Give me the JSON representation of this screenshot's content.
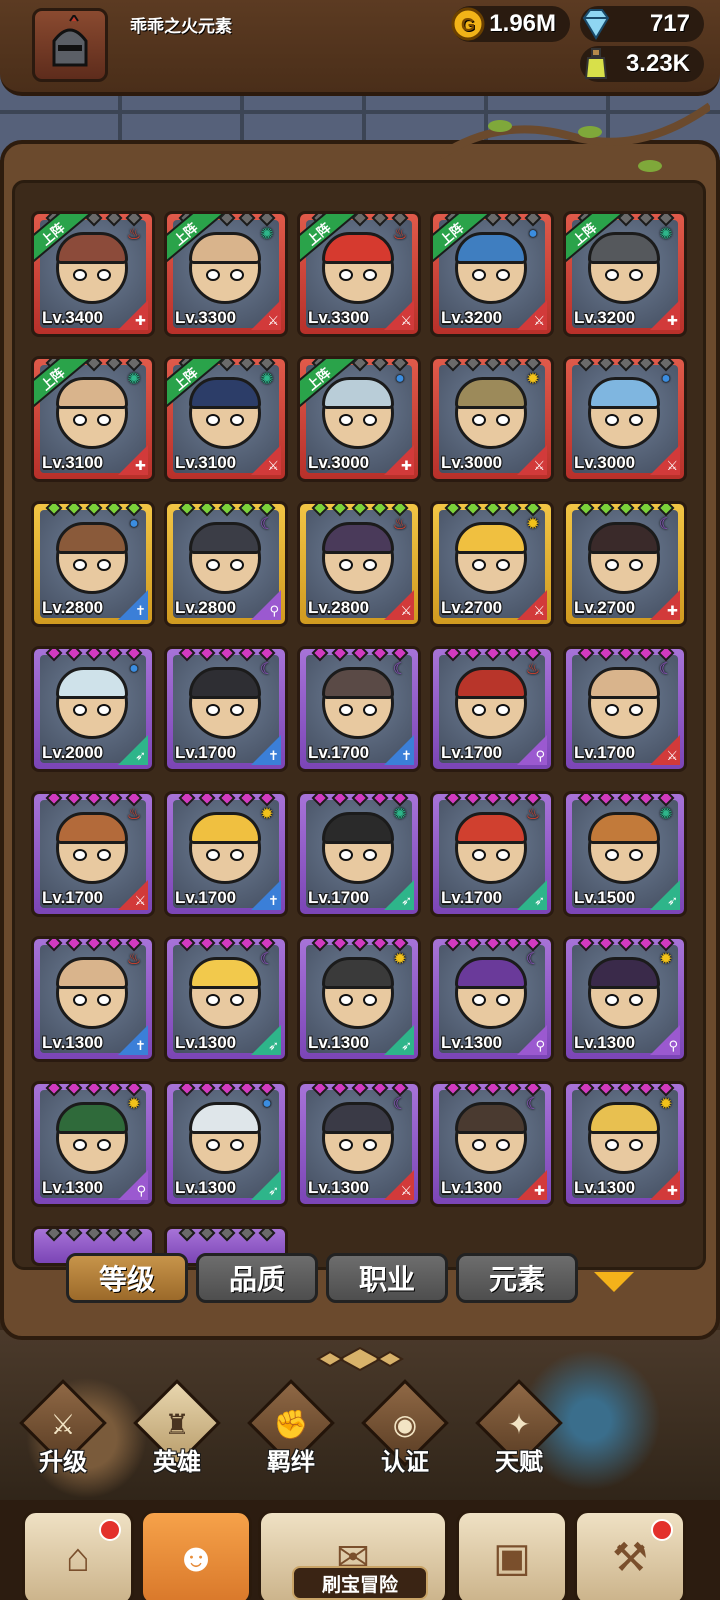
{
  "player": {
    "name": "乖乖之火元素"
  },
  "resources": {
    "gold": "1.96M",
    "gems": "717",
    "potions": "3.23K"
  },
  "deploy_tag": "上阵",
  "heroes": [
    {
      "level": "Lv.3400",
      "rarity": "red",
      "deployed": true,
      "element": "fire",
      "class": "guardian",
      "color": "#8c4b3a"
    },
    {
      "level": "Lv.3300",
      "rarity": "red",
      "deployed": true,
      "element": "wind",
      "class": "warrior",
      "color": "#d9b48c"
    },
    {
      "level": "Lv.3300",
      "rarity": "red",
      "deployed": true,
      "element": "fire",
      "class": "warrior",
      "color": "#d63a2f"
    },
    {
      "level": "Lv.3200",
      "rarity": "red",
      "deployed": true,
      "element": "water",
      "class": "warrior",
      "color": "#3f7ec0"
    },
    {
      "level": "Lv.3200",
      "rarity": "red",
      "deployed": true,
      "element": "wind",
      "class": "guardian",
      "color": "#55585c"
    },
    {
      "level": "Lv.3100",
      "rarity": "red",
      "deployed": true,
      "element": "wind",
      "class": "guardian",
      "color": "#d9b48c"
    },
    {
      "level": "Lv.3100",
      "rarity": "red",
      "deployed": true,
      "element": "wind",
      "class": "warrior",
      "color": "#2c3d68"
    },
    {
      "level": "Lv.3000",
      "rarity": "red",
      "deployed": true,
      "element": "water",
      "class": "guardian",
      "color": "#b9cdd8"
    },
    {
      "level": "Lv.3000",
      "rarity": "red",
      "deployed": false,
      "element": "light",
      "class": "warrior",
      "color": "#9c8a5a"
    },
    {
      "level": "Lv.3000",
      "rarity": "red",
      "deployed": false,
      "element": "water",
      "class": "warrior",
      "color": "#7fb6e0"
    },
    {
      "level": "Lv.2800",
      "rarity": "gold",
      "deployed": false,
      "element": "water",
      "class": "priest",
      "color": "#8a5a3a"
    },
    {
      "level": "Lv.2800",
      "rarity": "gold",
      "deployed": false,
      "element": "dark",
      "class": "mage",
      "color": "#3b3d46"
    },
    {
      "level": "Lv.2800",
      "rarity": "gold",
      "deployed": false,
      "element": "fire",
      "class": "warrior",
      "color": "#4a3a5a"
    },
    {
      "level": "Lv.2700",
      "rarity": "gold",
      "deployed": false,
      "element": "light",
      "class": "warrior",
      "color": "#f0c040"
    },
    {
      "level": "Lv.2700",
      "rarity": "gold",
      "deployed": false,
      "element": "dark",
      "class": "guardian",
      "color": "#3a2a2a"
    },
    {
      "level": "Lv.2000",
      "rarity": "purple",
      "deployed": false,
      "element": "water",
      "class": "ranger",
      "color": "#cfe2ea"
    },
    {
      "level": "Lv.1700",
      "rarity": "purple",
      "deployed": false,
      "element": "dark",
      "class": "priest",
      "color": "#2e2e33"
    },
    {
      "level": "Lv.1700",
      "rarity": "purple",
      "deployed": false,
      "element": "dark",
      "class": "priest",
      "color": "#5a4a46"
    },
    {
      "level": "Lv.1700",
      "rarity": "purple",
      "deployed": false,
      "element": "fire",
      "class": "mage",
      "color": "#b8352a"
    },
    {
      "level": "Lv.1700",
      "rarity": "purple",
      "deployed": false,
      "element": "dark",
      "class": "warrior",
      "color": "#d9b48c"
    },
    {
      "level": "Lv.1700",
      "rarity": "purple",
      "deployed": false,
      "element": "fire",
      "class": "warrior",
      "color": "#b36a3a"
    },
    {
      "level": "Lv.1700",
      "rarity": "purple",
      "deployed": false,
      "element": "light",
      "class": "priest",
      "color": "#f0c040"
    },
    {
      "level": "Lv.1700",
      "rarity": "purple",
      "deployed": false,
      "element": "wind",
      "class": "ranger",
      "color": "#2a2a2a"
    },
    {
      "level": "Lv.1700",
      "rarity": "purple",
      "deployed": false,
      "element": "fire",
      "class": "ranger",
      "color": "#d0402f"
    },
    {
      "level": "Lv.1500",
      "rarity": "purple",
      "deployed": false,
      "element": "wind",
      "class": "ranger",
      "color": "#c27a3a"
    },
    {
      "level": "Lv.1300",
      "rarity": "purple",
      "deployed": false,
      "element": "fire",
      "class": "priest",
      "color": "#d9b48c"
    },
    {
      "level": "Lv.1300",
      "rarity": "purple",
      "deployed": false,
      "element": "dark",
      "class": "ranger",
      "color": "#f2c94c"
    },
    {
      "level": "Lv.1300",
      "rarity": "purple",
      "deployed": false,
      "element": "light",
      "class": "ranger",
      "color": "#3a3a3a"
    },
    {
      "level": "Lv.1300",
      "rarity": "purple",
      "deployed": false,
      "element": "dark",
      "class": "mage",
      "color": "#6a3a9a"
    },
    {
      "level": "Lv.1300",
      "rarity": "purple",
      "deployed": false,
      "element": "light",
      "class": "mage",
      "color": "#3a2a4a"
    },
    {
      "level": "Lv.1300",
      "rarity": "purple",
      "deployed": false,
      "element": "light",
      "class": "mage",
      "color": "#2f6a3a"
    },
    {
      "level": "Lv.1300",
      "rarity": "purple",
      "deployed": false,
      "element": "water",
      "class": "ranger",
      "color": "#dfe6ea"
    },
    {
      "level": "Lv.1300",
      "rarity": "purple",
      "deployed": false,
      "element": "dark",
      "class": "warrior",
      "color": "#3a3a46"
    },
    {
      "level": "Lv.1300",
      "rarity": "purple",
      "deployed": false,
      "element": "dark",
      "class": "guardian",
      "color": "#4a3a30"
    },
    {
      "level": "Lv.1300",
      "rarity": "purple",
      "deployed": false,
      "element": "light",
      "class": "guardian",
      "color": "#e8c050"
    }
  ],
  "partial_row_count": 2,
  "element_glyphs": {
    "fire": "♨",
    "wind": "✺",
    "water": "●",
    "light": "✹",
    "dark": "☾"
  },
  "element_colors": {
    "fire": "#e8442c",
    "wind": "#2eb58a",
    "water": "#3b8de0",
    "light": "#f2c21a",
    "dark": "#9b59d0"
  },
  "class_glyphs": {
    "guardian": "✚",
    "warrior": "⚔",
    "priest": "✝",
    "mage": "⚲",
    "ranger": "➶"
  },
  "class_colors": {
    "guardian": "#d23a3a",
    "warrior": "#d23a3a",
    "priest": "#3b7fd8",
    "mage": "#9b59d0",
    "ranger": "#2eb58a"
  },
  "star_colors": {
    "red": "#6a6a6a",
    "gold": "#7bd23a",
    "purple": "#d23ac0"
  },
  "filters": [
    {
      "label": "等级",
      "active": true
    },
    {
      "label": "品质",
      "active": false
    },
    {
      "label": "职业",
      "active": false
    },
    {
      "label": "元素",
      "active": false
    }
  ],
  "categories": [
    {
      "label": "升级",
      "icon": "⚔",
      "active": false
    },
    {
      "label": "英雄",
      "icon": "♜",
      "active": true
    },
    {
      "label": "羁绊",
      "icon": "✊",
      "active": false
    },
    {
      "label": "认证",
      "icon": "◉",
      "active": false
    },
    {
      "label": "天赋",
      "icon": "✦",
      "active": false
    }
  ],
  "bottom_nav": [
    {
      "name": "shop",
      "icon": "⌂",
      "badge": true,
      "active": false
    },
    {
      "name": "heroes",
      "icon": "☻",
      "badge": false,
      "active": true
    },
    {
      "name": "adventure",
      "icon": "✉",
      "badge": false,
      "active": false
    },
    {
      "name": "inventory",
      "icon": "▣",
      "badge": false,
      "active": false
    },
    {
      "name": "forge",
      "icon": "⚒",
      "badge": true,
      "active": false
    }
  ],
  "adventure_label": "刷宝冒险"
}
